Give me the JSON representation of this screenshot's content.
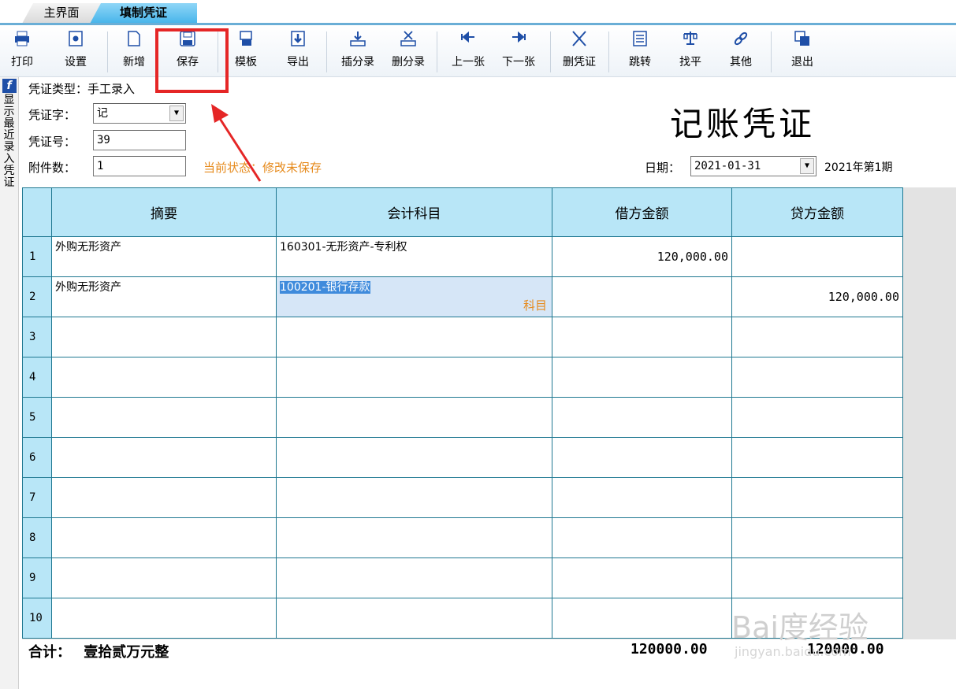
{
  "tabs": [
    {
      "label": "主界面"
    },
    {
      "label": "填制凭证"
    }
  ],
  "toolbar": {
    "items": [
      {
        "label": "打印",
        "icon": "printer-icon"
      },
      {
        "label": "设置",
        "icon": "settings-icon"
      },
      {
        "label": "新增",
        "icon": "new-doc-icon"
      },
      {
        "label": "保存",
        "icon": "save-icon"
      },
      {
        "label": "模板",
        "icon": "template-icon"
      },
      {
        "label": "导出",
        "icon": "export-icon"
      },
      {
        "label": "插分录",
        "icon": "insert-entry-icon"
      },
      {
        "label": "删分录",
        "icon": "delete-entry-icon"
      },
      {
        "label": "上一张",
        "icon": "previous-icon"
      },
      {
        "label": "下一张",
        "icon": "next-icon"
      },
      {
        "label": "删凭证",
        "icon": "delete-voucher-icon"
      },
      {
        "label": "跳转",
        "icon": "jump-icon"
      },
      {
        "label": "找平",
        "icon": "balance-icon"
      },
      {
        "label": "其他",
        "icon": "other-icon"
      },
      {
        "label": "退出",
        "icon": "exit-icon"
      }
    ]
  },
  "side": {
    "label": "显示最近录入凭证"
  },
  "header": {
    "voucher_type_label": "凭证类型：",
    "voucher_type_value": "手工录入",
    "voucher_word_label": "凭证字：",
    "voucher_word_value": "记",
    "voucher_no_label": "凭证号：",
    "voucher_no_value": "39",
    "attachments_label": "附件数：",
    "attachments_value": "1",
    "status_label": "当前状态：",
    "status_value": "修改未保存",
    "title": "记账凭证",
    "date_label": "日期：",
    "date_value": "2021-01-31",
    "period": "2021年第1期"
  },
  "table": {
    "columns": [
      "摘要",
      "会计科目",
      "借方金额",
      "贷方金额"
    ],
    "rows": [
      {
        "no": "1",
        "summary": "外购无形资产",
        "account": "160301-无形资产-专利权",
        "debit": "120,000.00",
        "credit": ""
      },
      {
        "no": "2",
        "summary": "外购无形资产",
        "account": "100201-银行存款",
        "debit": "",
        "credit": "120,000.00",
        "tag": "科目"
      },
      {
        "no": "3",
        "summary": "",
        "account": "",
        "debit": "",
        "credit": ""
      },
      {
        "no": "4",
        "summary": "",
        "account": "",
        "debit": "",
        "credit": ""
      },
      {
        "no": "5",
        "summary": "",
        "account": "",
        "debit": "",
        "credit": ""
      },
      {
        "no": "6",
        "summary": "",
        "account": "",
        "debit": "",
        "credit": ""
      },
      {
        "no": "7",
        "summary": "",
        "account": "",
        "debit": "",
        "credit": ""
      },
      {
        "no": "8",
        "summary": "",
        "account": "",
        "debit": "",
        "credit": ""
      },
      {
        "no": "9",
        "summary": "",
        "account": "",
        "debit": "",
        "credit": ""
      },
      {
        "no": "10",
        "summary": "",
        "account": "",
        "debit": "",
        "credit": ""
      }
    ]
  },
  "totals": {
    "label": "合计：",
    "amount_words": "壹拾贰万元整",
    "debit_total": "120000.00",
    "credit_total": "120000.00"
  },
  "watermark": {
    "logo": "Bai度经验",
    "url": "jingyan.baidu.com"
  },
  "colors": {
    "header_bg": "#b8e6f7",
    "grid_line": "#1f7891",
    "status": "#e68a1c",
    "highlight": "#e52626",
    "active_tab": "#46b4ea"
  }
}
